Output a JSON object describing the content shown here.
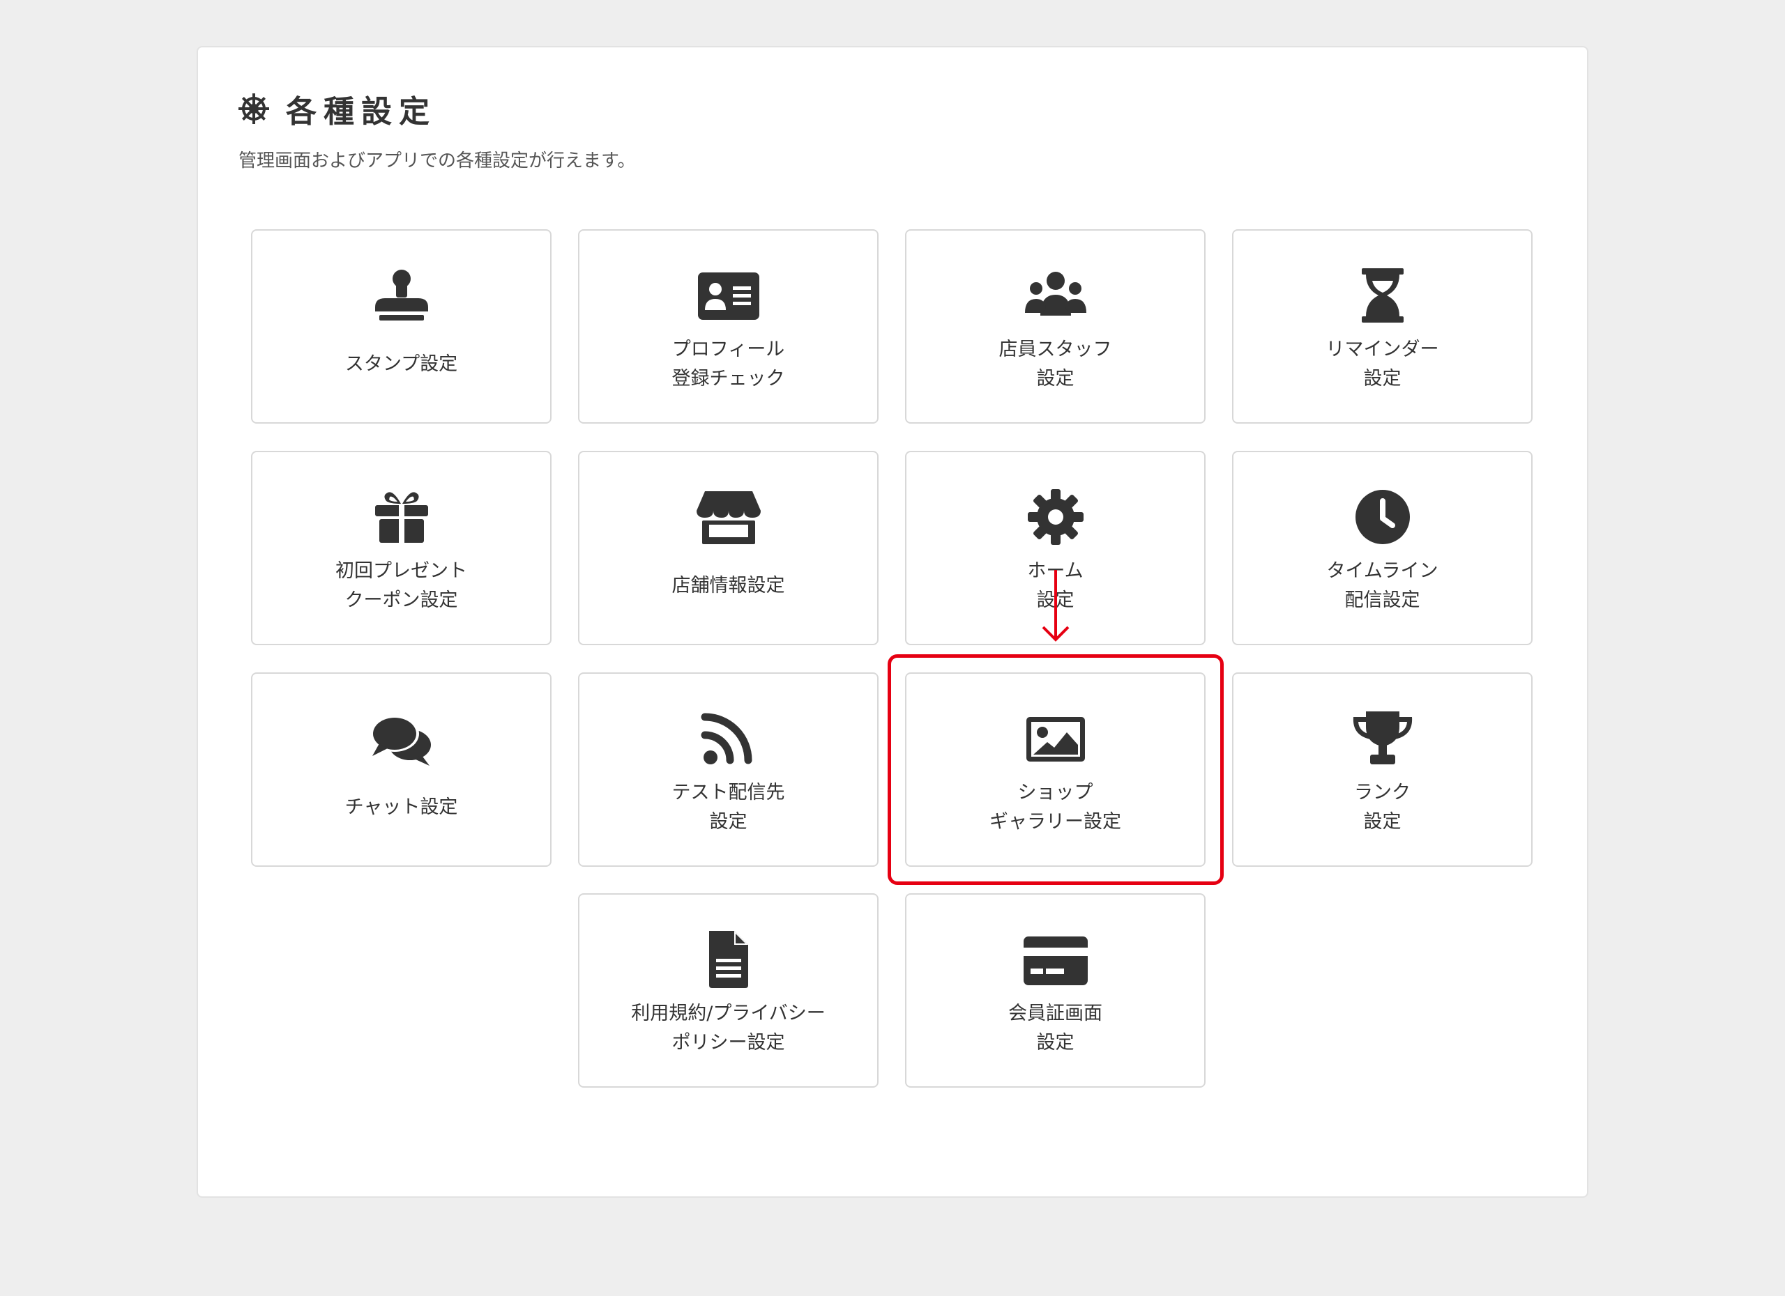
{
  "header": {
    "title": "各種設定",
    "subtitle": "管理画面およびアプリでの各種設定が行えます。",
    "icon": "gear-icon"
  },
  "colors": {
    "background": "#eeeeee",
    "panel": "#ffffff",
    "icon": "#333333",
    "highlight": "#e60012"
  },
  "tiles": [
    {
      "id": "stamp",
      "icon": "stamp-icon",
      "lines": [
        "スタンプ設定"
      ]
    },
    {
      "id": "profile",
      "icon": "id-card-icon",
      "lines": [
        "プロフィール",
        "登録チェック"
      ]
    },
    {
      "id": "staff",
      "icon": "users-icon",
      "lines": [
        "店員スタッフ",
        "設定"
      ]
    },
    {
      "id": "reminder",
      "icon": "hourglass-icon",
      "lines": [
        "リマインダー",
        "設定"
      ]
    },
    {
      "id": "coupon",
      "icon": "gift-icon",
      "lines": [
        "初回プレゼント",
        "クーポン設定"
      ]
    },
    {
      "id": "store-info",
      "icon": "store-icon",
      "lines": [
        "店舗情報設定"
      ]
    },
    {
      "id": "home",
      "icon": "cog-icon",
      "lines": [
        "ホーム",
        "設定"
      ]
    },
    {
      "id": "timeline",
      "icon": "clock-icon",
      "lines": [
        "タイムライン",
        "配信設定"
      ]
    },
    {
      "id": "chat",
      "icon": "comments-icon",
      "lines": [
        "チャット設定"
      ]
    },
    {
      "id": "test-delivery",
      "icon": "rss-icon",
      "lines": [
        "テスト配信先",
        "設定"
      ]
    },
    {
      "id": "gallery",
      "icon": "image-icon",
      "lines": [
        "ショップ",
        "ギャラリー設定"
      ]
    },
    {
      "id": "rank",
      "icon": "trophy-icon",
      "lines": [
        "ランク",
        "設定"
      ]
    },
    {
      "id": "terms",
      "icon": "document-icon",
      "lines": [
        "利用規約/プライバシー",
        "ポリシー設定"
      ]
    },
    {
      "id": "member-card",
      "icon": "credit-card-icon",
      "lines": [
        "会員証画面",
        "設定"
      ]
    }
  ],
  "annotation": {
    "highlighted_tile": "gallery"
  }
}
